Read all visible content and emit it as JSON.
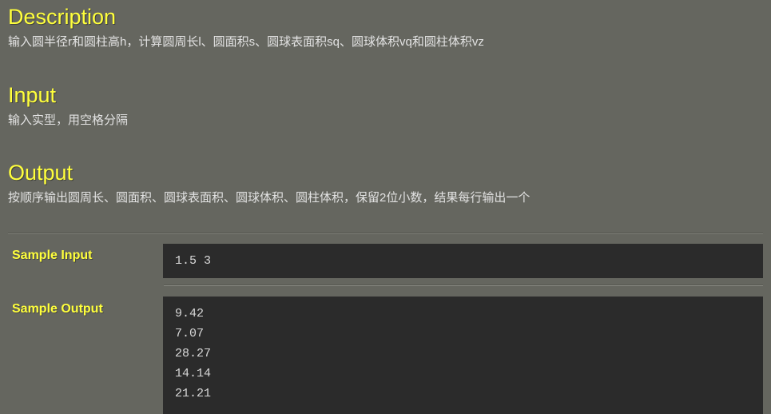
{
  "sections": [
    {
      "heading": "Description",
      "body": "输入圆半径r和圆柱高h，计算圆周长l、圆面积s、圆球表面积sq、圆球体积vq和圆柱体积vz"
    },
    {
      "heading": "Input",
      "body": "输入实型，用空格分隔"
    },
    {
      "heading": "Output",
      "body": "按顺序输出圆周长、圆面积、圆球表面积、圆球体积、圆柱体积，保留2位小数，结果每行输出一个"
    }
  ],
  "samples": {
    "input_label": "Sample Input",
    "input_code": "1.5 3",
    "output_label": "Sample Output",
    "output_code": "9.42\n7.07\n28.27\n14.14\n21.21"
  },
  "colors": {
    "page_background": "#65665F",
    "heading": "#FFFF3C",
    "body_text": "#E2E2E2",
    "code_background": "#2B2B2B",
    "code_text": "#D8D8D8"
  }
}
